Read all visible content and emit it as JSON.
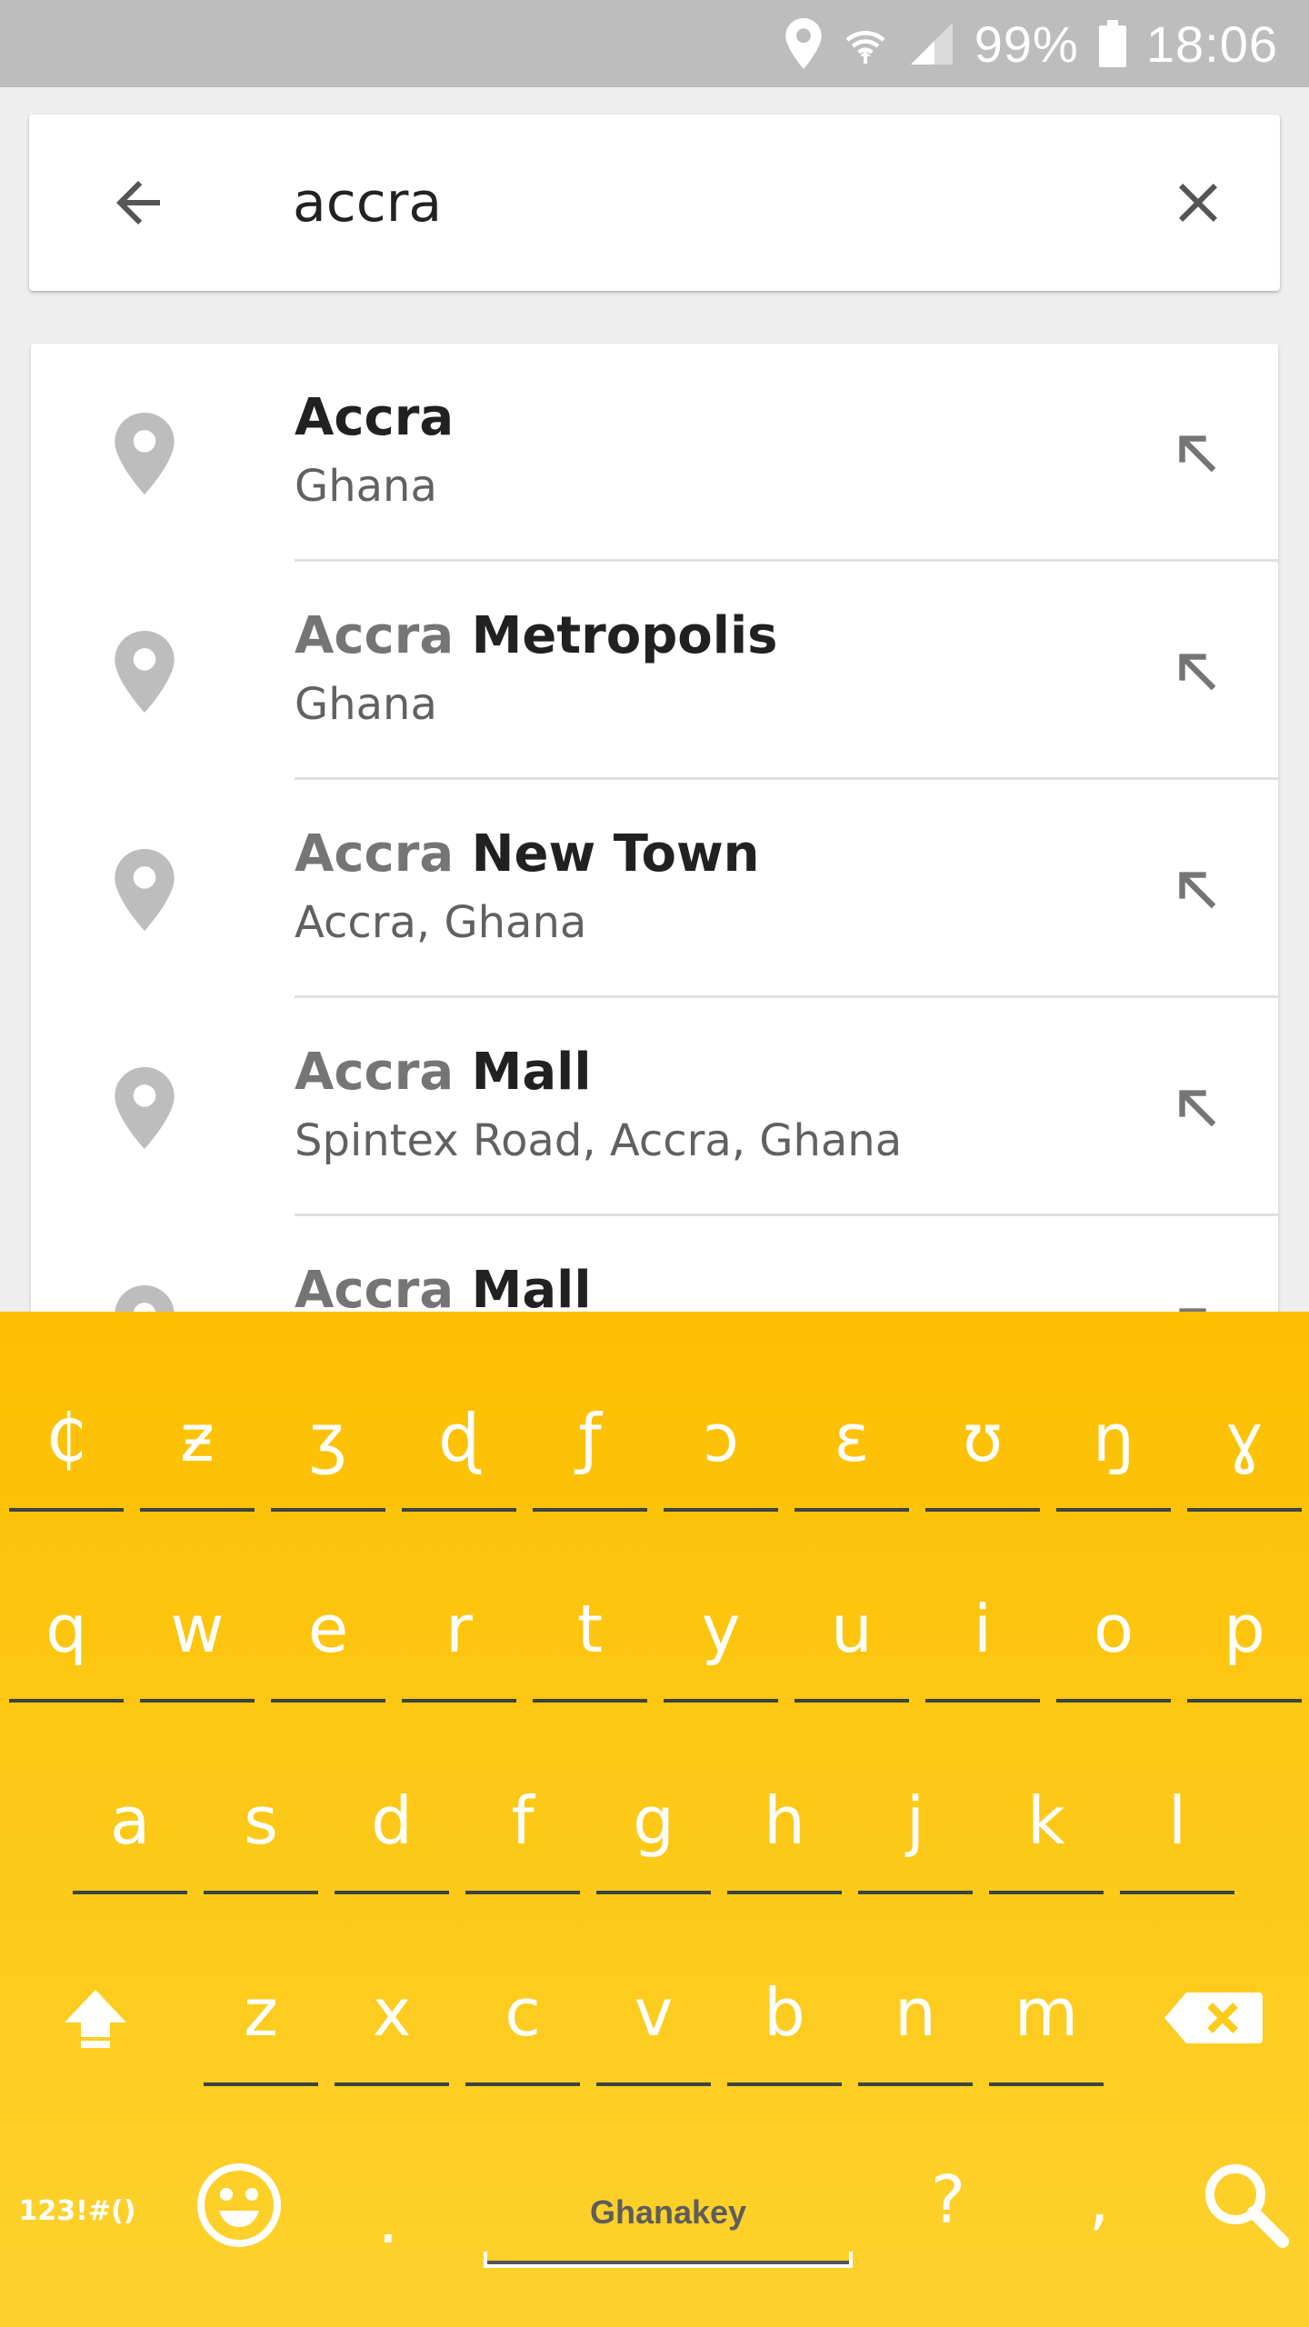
{
  "status": {
    "battery": "99%",
    "time": "18:06"
  },
  "search": {
    "query": "accra"
  },
  "results": [
    {
      "match": "Accra",
      "rest": "",
      "subtitle": "Ghana"
    },
    {
      "match": "Accra",
      "rest": " Metropolis",
      "subtitle": "Ghana"
    },
    {
      "match": "Accra",
      "rest": " New Town",
      "subtitle": "Accra, Ghana"
    },
    {
      "match": "Accra",
      "rest": " Mall",
      "subtitle": "Spintex Road, Accra, Ghana"
    },
    {
      "match": "Accra",
      "rest": " Mall",
      "subtitle": ""
    }
  ],
  "keyboard": {
    "row_special": [
      "₵",
      "ƶ",
      "ʒ",
      "ɖ",
      "ƒ",
      "ɔ",
      "ɛ",
      "ʊ",
      "ŋ",
      "ɣ"
    ],
    "row1": [
      "q",
      "w",
      "e",
      "r",
      "t",
      "y",
      "u",
      "i",
      "o",
      "p"
    ],
    "row2": [
      "a",
      "s",
      "d",
      "f",
      "g",
      "h",
      "j",
      "k",
      "l"
    ],
    "row3": [
      "z",
      "x",
      "c",
      "v",
      "b",
      "n",
      "m"
    ],
    "symbols_label": "123!#()",
    "period": ".",
    "space_brand": "Ghanakey",
    "question": "?",
    "comma": ",",
    "icons": [
      "shift-icon",
      "backspace-icon",
      "emoji-icon",
      "search-icon"
    ]
  },
  "colors": {
    "keyboard_top": "#fdbf00",
    "keyboard_bottom": "#fdd22e"
  }
}
